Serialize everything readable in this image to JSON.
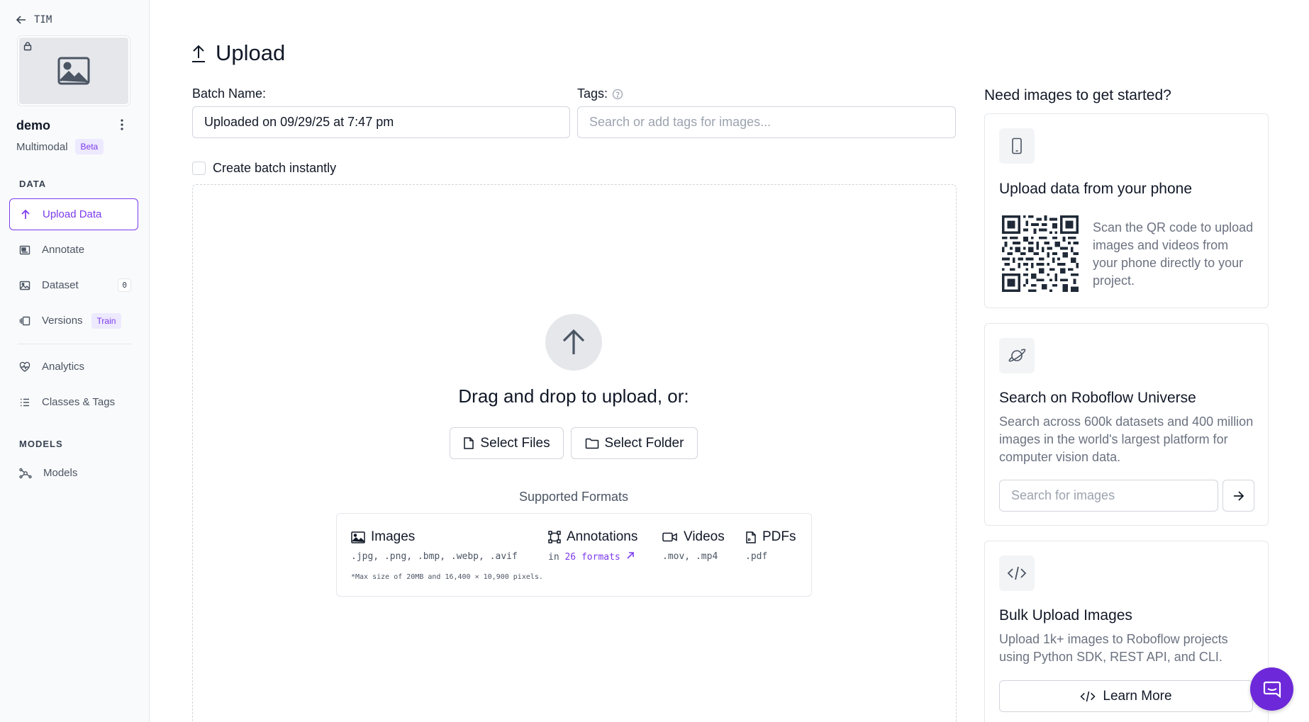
{
  "sidebar": {
    "back_label": "TIM",
    "project_name": "demo",
    "project_type": "Multimodal",
    "project_badge": "Beta",
    "data_section": "DATA",
    "models_section": "MODELS",
    "items": [
      {
        "label": "Upload Data",
        "icon": "upload-icon",
        "active": true
      },
      {
        "label": "Annotate",
        "icon": "annotate-icon"
      },
      {
        "label": "Dataset",
        "icon": "dataset-icon",
        "count": "0"
      },
      {
        "label": "Versions",
        "icon": "versions-icon",
        "badge": "Train"
      },
      {
        "label": "Analytics",
        "icon": "analytics-icon"
      },
      {
        "label": "Classes & Tags",
        "icon": "list-icon"
      },
      {
        "label": "Models",
        "icon": "models-icon"
      }
    ]
  },
  "main": {
    "title": "Upload",
    "batch_label": "Batch Name:",
    "batch_value": "Uploaded on 09/29/25 at 7:47 pm",
    "tags_label": "Tags:",
    "tags_placeholder": "Search or add tags for images...",
    "checkbox_label": "Create batch instantly",
    "drop_title": "Drag and drop to upload, or:",
    "select_files": "Select Files",
    "select_folder": "Select Folder",
    "supported_label": "Supported Formats",
    "formats": {
      "images_label": "Images",
      "images_ext": ".jpg, .png, .bmp, .webp, .avif",
      "annotations_label": "Annotations",
      "annotations_prefix": "in",
      "annotations_link": "26 formats",
      "videos_label": "Videos",
      "videos_ext": ".mov, .mp4",
      "pdfs_label": "PDFs",
      "pdfs_ext": ".pdf",
      "note": "*Max size of 20MB and 16,400 × 10,900 pixels."
    }
  },
  "right_panel": {
    "title": "Need images to get started?",
    "phone": {
      "title": "Upload data from your phone",
      "text": "Scan the QR code to upload images and videos from your phone directly to your project."
    },
    "universe": {
      "title": "Search on Roboflow Universe",
      "text": "Search across 600k datasets and 400 million images in the world's largest platform for computer vision data.",
      "placeholder": "Search for images"
    },
    "bulk": {
      "title": "Bulk Upload Images",
      "text": "Upload 1k+ images to Roboflow projects using Python SDK, REST API, and CLI.",
      "button": "Learn More"
    }
  },
  "colors": {
    "accent": "#7c3aed",
    "chat": "#6d28d9"
  }
}
